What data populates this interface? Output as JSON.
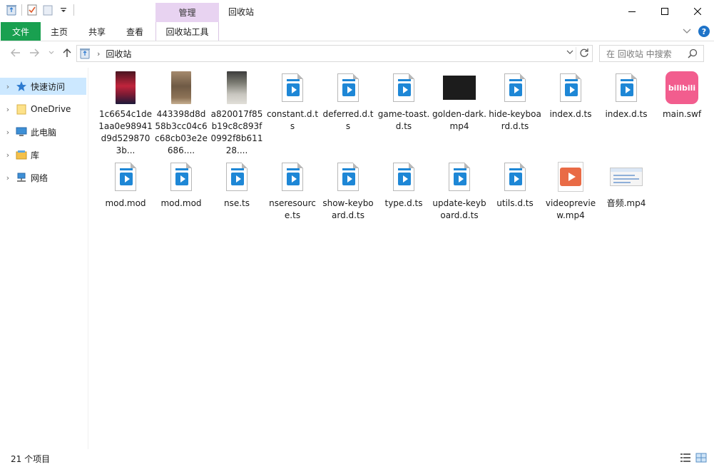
{
  "window": {
    "context_tab": "管理",
    "title": "回收站"
  },
  "ribbon": {
    "tabs": [
      "文件",
      "主页",
      "共享",
      "查看",
      "回收站工具"
    ]
  },
  "address": {
    "path": "回收站",
    "search_placeholder": "在 回收站 中搜索"
  },
  "nav": {
    "items": [
      {
        "label": "快速访问",
        "icon": "star-icon",
        "selected": true
      },
      {
        "label": "OneDrive",
        "icon": "folder-icon",
        "selected": false
      },
      {
        "label": "此电脑",
        "icon": "computer-icon",
        "selected": false
      },
      {
        "label": "库",
        "icon": "library-icon",
        "selected": false
      },
      {
        "label": "网络",
        "icon": "network-icon",
        "selected": false
      }
    ]
  },
  "files": [
    {
      "name": "1c6654c1de1aa0e98941d9d5298703b...",
      "icon": "video-thumbnail-red"
    },
    {
      "name": "443398d8d58b3cc04c6c68cb03e2e686....",
      "icon": "video-thumbnail-brown"
    },
    {
      "name": "a820017f85b19c8c893f0992f8b61128....",
      "icon": "video-thumbnail-grey"
    },
    {
      "name": "constant.d.ts",
      "icon": "media-file-icon"
    },
    {
      "name": "deferred.d.ts",
      "icon": "media-file-icon"
    },
    {
      "name": "game-toast.d.ts",
      "icon": "media-file-icon"
    },
    {
      "name": "golden-dark.mp4",
      "icon": "black-video-thumbnail"
    },
    {
      "name": "hide-keyboard.d.ts",
      "icon": "media-file-icon"
    },
    {
      "name": "index.d.ts",
      "icon": "media-file-icon"
    },
    {
      "name": "index.d.ts",
      "icon": "media-file-icon"
    },
    {
      "name": "main.swf",
      "icon": "bilibili-icon"
    },
    {
      "name": "mod.mod",
      "icon": "media-file-icon"
    },
    {
      "name": "mod.mod",
      "icon": "media-file-icon"
    },
    {
      "name": "nse.ts",
      "icon": "media-file-icon"
    },
    {
      "name": "nseresource.ts",
      "icon": "media-file-icon"
    },
    {
      "name": "show-keyboard.d.ts",
      "icon": "media-file-icon"
    },
    {
      "name": "type.d.ts",
      "icon": "media-file-icon"
    },
    {
      "name": "update-keyboard.d.ts",
      "icon": "media-file-icon"
    },
    {
      "name": "utils.d.ts",
      "icon": "media-file-icon"
    },
    {
      "name": "videopreview.mp4",
      "icon": "orange-play-icon"
    },
    {
      "name": "音频.mp4",
      "icon": "screenshot-thumbnail"
    }
  ],
  "bilibili_label": "bilibili",
  "status": {
    "item_count": "21 个项目"
  }
}
